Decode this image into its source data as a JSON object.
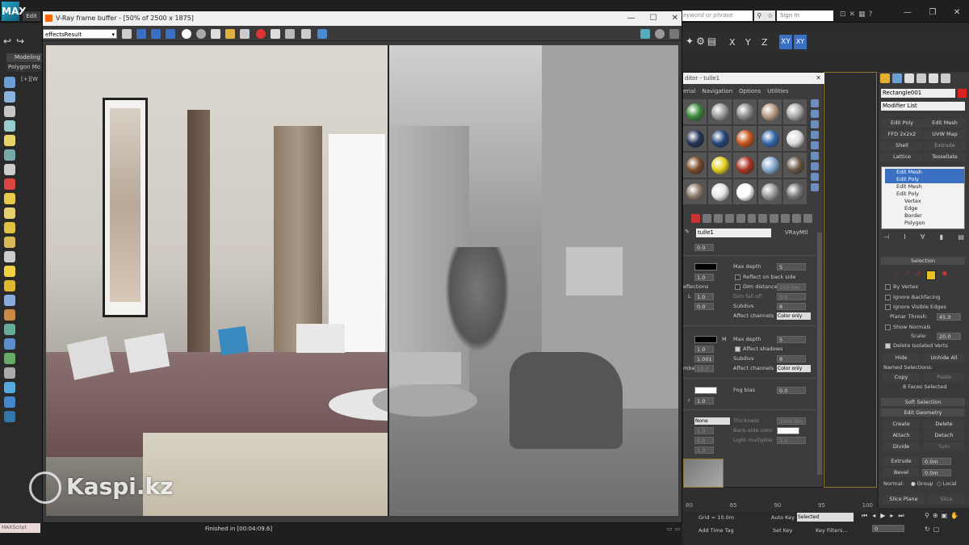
{
  "app": {
    "logo_text": "MAX",
    "file_tab": "Edit",
    "search_placeholder": "Type a keyword or phrase",
    "search_display": "eyword or phrase",
    "sign_in": "Sign In"
  },
  "left": {
    "tab_modeling": "Modeling",
    "tab_poly": "Polygon Mo",
    "viewport_label": "[+][W"
  },
  "vfb": {
    "title": "V-Ray frame buffer - [50% of 2500 x 1875]",
    "channel": "effectsResult",
    "status": "Finished in [00:04:09.6]"
  },
  "material_editor": {
    "title": "ditor - tulle1",
    "menu": [
      "erial",
      "Navigation",
      "Options",
      "Utilities"
    ],
    "slot_colors": [
      "#3a8a3a",
      "#9a9a9a",
      "#8a8a8a",
      "#b89a82",
      "#aaaaaa",
      "#223355",
      "#224477",
      "#c8551c",
      "#3366aa",
      "#dddddd",
      "#7a4a2a",
      "#e0d020",
      "#aa3322",
      "#88aacc",
      "#665544",
      "#887766",
      "#e8e8e8",
      "#ffffff",
      "#999999",
      "#777777"
    ],
    "mat_name": "tulle1",
    "mat_type": "VRayMtl",
    "top_value": "0.0",
    "refl": {
      "max_depth_label": "Max depth",
      "max_depth": "5",
      "reflect_back": "Reflect on back side",
      "dim_distance": "Dim distance",
      "dim_value": "100.0m",
      "dim_falloff": "Dim fall off",
      "dim_falloff_value": "0.0",
      "section": "eflections",
      "l_label": "L",
      "val1": "1.0",
      "val2": "1.0",
      "val3": "0.0",
      "subdivs_label": "Subdivs",
      "subdivs": "8",
      "affect_label": "Affect channels",
      "affect": "Color only"
    },
    "refr": {
      "max_depth_label": "Max depth",
      "max_depth": "5",
      "m_label": "M",
      "affect_shadows": "Affect shadows",
      "number_label": "mber",
      "val1": "1.0",
      "val2": "1.001",
      "val3": "10.0",
      "subdivs_label": "Subdivs",
      "subdivs": "8",
      "affect_label": "Affect channels",
      "affect": "Color only"
    },
    "fog": {
      "label": "Fog bias",
      "value": "0.0",
      "r_label": "r",
      "r_value": "1.0"
    },
    "trans": {
      "none": "None",
      "thickness": "Thickness",
      "thickness_value": "1000.0m",
      "back_side": "Back-side color",
      "light_mult": "Light multiplier",
      "light_value": "1.0",
      "v1": "1.0",
      "v2": "0.0",
      "v3": "1.0",
      "v4": "1.0"
    }
  },
  "toolbar": {
    "x": "X",
    "y": "Y",
    "z": "Z",
    "xy": "XY",
    "xy2": "XY"
  },
  "command_panel": {
    "object_name": "Rectangle001",
    "modifier_list": "Modifier List",
    "buttons": [
      "Edit Poly",
      "Edit Mesh",
      "FFD 2x2x2",
      "UVW Map",
      "Shell",
      "Extrude",
      "Lattice",
      "Tessellate"
    ],
    "stack": [
      {
        "label": "Edit Mesh",
        "selected": true
      },
      {
        "label": "Edit Poly",
        "selected": true
      },
      {
        "label": "Edit Mesh",
        "selected": false
      },
      {
        "label": "Edit Poly",
        "selected": false
      },
      {
        "label": "Vertex",
        "selected": false
      },
      {
        "label": "Edge",
        "selected": false
      },
      {
        "label": "Border",
        "selected": false
      },
      {
        "label": "Polygon",
        "selected": false
      }
    ],
    "selection": {
      "header": "Selection",
      "by_vertex": "By Vertex",
      "ignore_backfacing": "Ignore Backfacing",
      "ignore_visible": "Ignore Visible Edges",
      "planar_label": "Planar Thresh:",
      "planar_value": "45.0",
      "show_normals": "Show Normals",
      "scale_label": "Scale:",
      "scale_value": "20.0",
      "delete_isolated": "Delete Isolated Verts",
      "hide": "Hide",
      "unhide_all": "Unhide All",
      "named_sel": "Named Selections:",
      "copy": "Copy",
      "paste": "Paste",
      "faces_selected": "8 Faces Selected"
    },
    "soft_selection": "Soft Selection",
    "edit_geometry": {
      "header": "Edit Geometry",
      "create": "Create",
      "delete": "Delete",
      "attach": "Attach",
      "detach": "Detach",
      "divide": "Divide",
      "turn": "Turn",
      "extrude": "Extrude",
      "extrude_value": "0.0m",
      "bevel": "Bevel",
      "bevel_value": "0.0m",
      "normal": "Normal:",
      "group": "Group",
      "local": "Local",
      "slice_plane": "Slice Plane",
      "slice": "Slice"
    }
  },
  "timeline": {
    "ticks": [
      "80",
      "85",
      "90",
      "95",
      "100"
    ]
  },
  "status": {
    "maxscript": "MAXScript",
    "grid": "Grid = 10.0m",
    "add_time_tag": "Add Time Tag",
    "auto_key": "Auto Key",
    "selected": "Selected",
    "set_key": "Set Key",
    "key_filters": "Key Filters...",
    "frame": "0"
  },
  "watermark": "Kaspi.kz"
}
